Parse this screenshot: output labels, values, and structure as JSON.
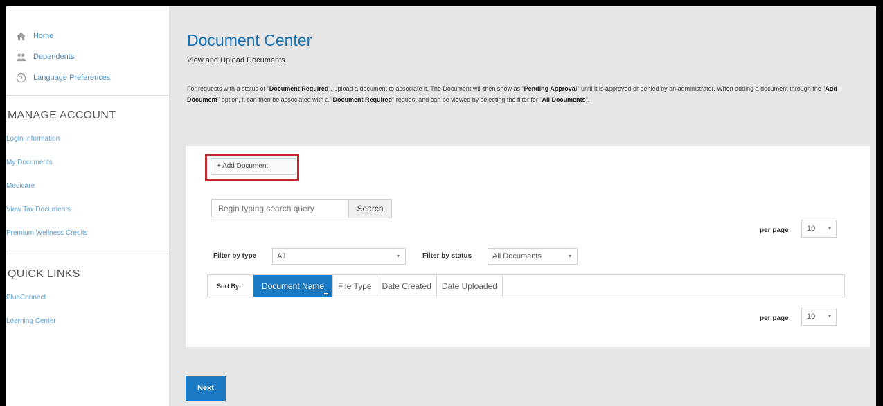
{
  "sidebar": {
    "nav": [
      {
        "label": "Home",
        "icon": "home-icon"
      },
      {
        "label": "Dependents",
        "icon": "people-icon"
      },
      {
        "label": "Language Preferences",
        "icon": "globe-icon"
      }
    ],
    "manage_account": {
      "heading": "MANAGE ACCOUNT",
      "links": [
        "Login Information",
        "My Documents",
        "Medicare",
        "View Tax Documents",
        "Premium Wellness Credits"
      ]
    },
    "quick_links": {
      "heading": "QUICK LINKS",
      "links": [
        "BlueConnect",
        "Learning Center"
      ]
    }
  },
  "page": {
    "title": "Document Center",
    "subtitle": "View and Upload Documents",
    "intro": {
      "t1": "For requests with a status of \"",
      "b1": "Document Required",
      "t2": "\", upload a document to associate it. The Document will then show as \"",
      "b2": "Pending Approval",
      "t3": "\" until it is approved or denied by an administrator. When adding a document through the \"",
      "b3": "Add Document",
      "t4": "\" option, it can then be associated with a \"",
      "b4": "Document Required",
      "t5": "\" request and can be viewed by selecting the filter for \"",
      "b5": "All Documents",
      "t6": "\"."
    }
  },
  "panel": {
    "add_document_label": "+  Add Document",
    "search": {
      "placeholder": "Begin typing search query",
      "button": "Search"
    },
    "per_page": {
      "label": "per page",
      "value": "10"
    },
    "filter_type": {
      "label": "Filter by type",
      "value": "All"
    },
    "filter_status": {
      "label": "Filter by status",
      "value": "All Documents"
    },
    "sort": {
      "label": "Sort By:",
      "options": [
        "Document Name",
        "File Type",
        "Date Created",
        "Date Uploaded"
      ],
      "active": "Document Name"
    }
  },
  "footer": {
    "next_label": "Next"
  },
  "colors": {
    "accent": "#1a7ac4",
    "title": "#1a73b5",
    "highlight": "#c0262d",
    "link": "#5aa0d0"
  }
}
